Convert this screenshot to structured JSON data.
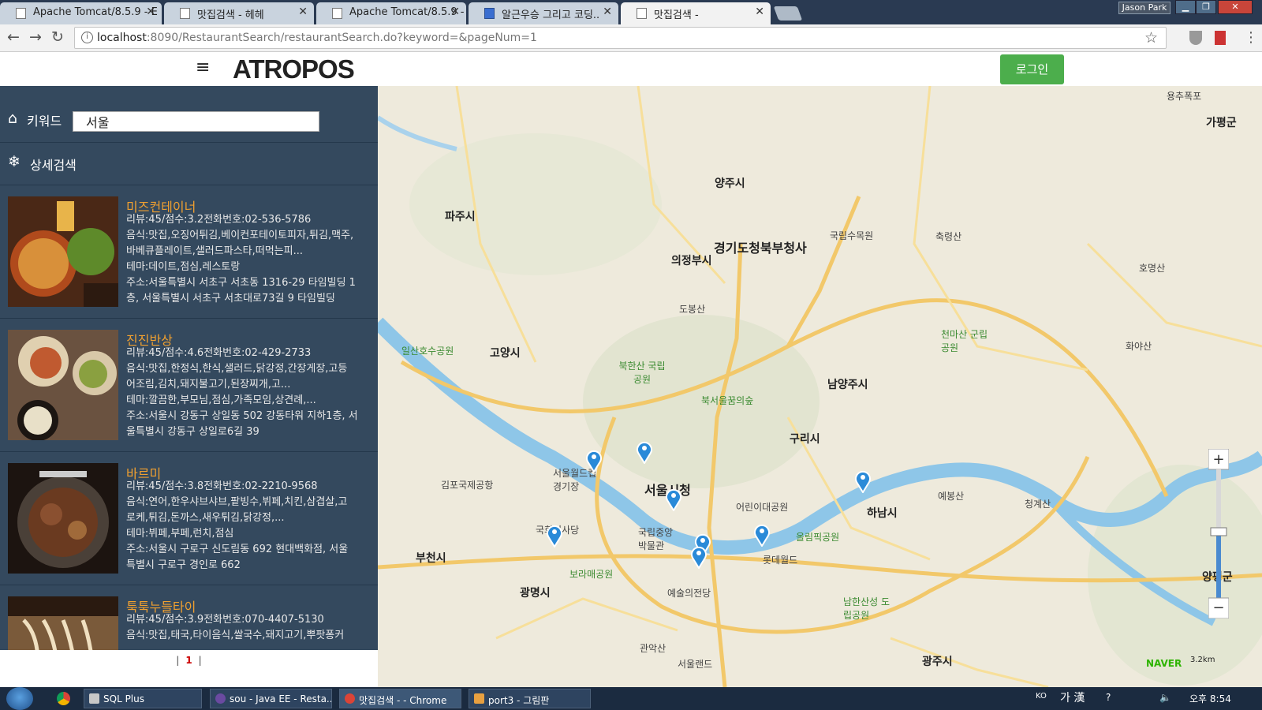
{
  "browser": {
    "tabs": [
      {
        "title": "Apache Tomcat/8.5.9 - E"
      },
      {
        "title": "맛집검색 - 헤헤"
      },
      {
        "title": "Apache Tomcat/8.5.9 - E"
      },
      {
        "title": "알근우승 그리고 코딩.."
      },
      {
        "title": "맛집검색 -"
      }
    ],
    "window_user": "Jason Park",
    "url_host": "localhost",
    "url_rest": ":8090/RestaurantSearch/restaurantSearch.do?keyword=&pageNum=1"
  },
  "header": {
    "logo": "ATROPOS",
    "login_label": "로그인"
  },
  "sidebar": {
    "keyword_label": "키워드",
    "keyword_value": "서울",
    "advanced_label": "상세검색",
    "restaurants": [
      {
        "name": "미즈컨테이너",
        "line1": "리뷰:45/점수:3.2전화번호:02-536-5786",
        "line2": "음식:맛집,오징어튀김,베이컨포테이토피자,튀김,맥주,",
        "line3": "바베큐플레이트,샐러드파스타,떠먹는피...",
        "line4": "테마:데이트,점심,레스토랑",
        "line5": "주소:서울특별시 서초구 서초동 1316-29 타임빌딩 1",
        "line6": "층, 서울특별시 서초구 서초대로73길 9 타임빌딩",
        "photo_color": "#6b3a1e"
      },
      {
        "name": "진진반상",
        "line1": "리뷰:45/점수:4.6전화번호:02-429-2733",
        "line2": "음식:맛집,한정식,한식,샐러드,닭강정,간장게장,고등",
        "line3": "어조림,김치,돼지불고기,된장찌개,고...",
        "line4": "테마:깔끔한,부모님,점심,가족모임,상견례,...",
        "line5": "주소:서울시 강동구 상일동 502 강동타워 지하1층, 서",
        "line6": "울특별시 강동구 상일로6길 39",
        "photo_color": "#5a4030"
      },
      {
        "name": "바르미",
        "line1": "리뷰:45/점수:3.8전화번호:02-2210-9568",
        "line2": "음식:연어,한우샤브샤브,팥빙수,뷔페,치킨,삼겹살,고",
        "line3": "로케,튀김,돈까스,새우튀김,닭강정,...",
        "line4": "테마:뷔페,부페,런치,점심",
        "line5": "주소:서울시 구로구 신도림동 692 현대백화점, 서울",
        "line6": "특별시 구로구 경인로 662",
        "photo_color": "#3a2a20"
      },
      {
        "name": "툭툭누들타이",
        "line1": "리뷰:45/점수:3.9전화번호:070-4407-5130",
        "line2": "음식:맛집,태국,타이음식,쌀국수,돼지고기,뿌팟퐁커",
        "line3": "",
        "line4": "",
        "line5": "",
        "line6": "",
        "photo_color": "#7a5a3a"
      }
    ],
    "pager": {
      "current": "1"
    }
  },
  "map": {
    "labels": [
      {
        "text": "파주시",
        "kind": "mid"
      },
      {
        "text": "양주시",
        "kind": "mid"
      },
      {
        "text": "경기도청북부청사",
        "kind": "big"
      },
      {
        "text": "의정부시",
        "kind": "mid"
      },
      {
        "text": "고양시",
        "kind": "mid"
      },
      {
        "text": "북한산 국립공원",
        "kind": "green"
      },
      {
        "text": "남양주시",
        "kind": "mid"
      },
      {
        "text": "구리시",
        "kind": "mid"
      },
      {
        "text": "서울시청",
        "kind": "big"
      },
      {
        "text": "하남시",
        "kind": "mid"
      },
      {
        "text": "부천시",
        "kind": "mid"
      },
      {
        "text": "광명시",
        "kind": "mid"
      },
      {
        "text": "광주시",
        "kind": "mid"
      },
      {
        "text": "양평군",
        "kind": "mid"
      },
      {
        "text": "가평군",
        "kind": "mid"
      },
      {
        "text": "천마산 군립공원",
        "kind": "green"
      },
      {
        "text": "남한산성 도립공원",
        "kind": "green"
      },
      {
        "text": "국회의사당",
        "kind": "small"
      },
      {
        "text": "서울월드컵경기장",
        "kind": "small"
      },
      {
        "text": "김포국제공항",
        "kind": "small"
      },
      {
        "text": "어린이대공원",
        "kind": "small"
      },
      {
        "text": "올림픽공원",
        "kind": "green"
      },
      {
        "text": "롯데월드",
        "kind": "small"
      },
      {
        "text": "보라매공원",
        "kind": "green"
      },
      {
        "text": "국립중앙박물관",
        "kind": "small"
      },
      {
        "text": "예술의전당",
        "kind": "small"
      },
      {
        "text": "서울랜드",
        "kind": "small"
      },
      {
        "text": "국립수목원",
        "kind": "small"
      },
      {
        "text": "도봉산",
        "kind": "small"
      },
      {
        "text": "예봉산",
        "kind": "small"
      },
      {
        "text": "청계산",
        "kind": "small"
      },
      {
        "text": "관악산",
        "kind": "small"
      },
      {
        "text": "축령산",
        "kind": "small"
      },
      {
        "text": "화야산",
        "kind": "small"
      },
      {
        "text": "호명산",
        "kind": "small"
      },
      {
        "text": "용추폭포",
        "kind": "small"
      },
      {
        "text": "일산호수공원",
        "kind": "green"
      },
      {
        "text": "북서울꿈의숲",
        "kind": "green"
      }
    ],
    "provider": "NAVER",
    "scale": "3.2km"
  },
  "taskbar": {
    "items": [
      {
        "label": "SQL Plus"
      },
      {
        "label": "sou - Java EE - Resta..."
      },
      {
        "label": "맛집검색 - - Chrome"
      },
      {
        "label": "port3 - 그림판"
      }
    ],
    "lang": "KO",
    "ime": "가 漢",
    "time": "오후 8:54"
  }
}
